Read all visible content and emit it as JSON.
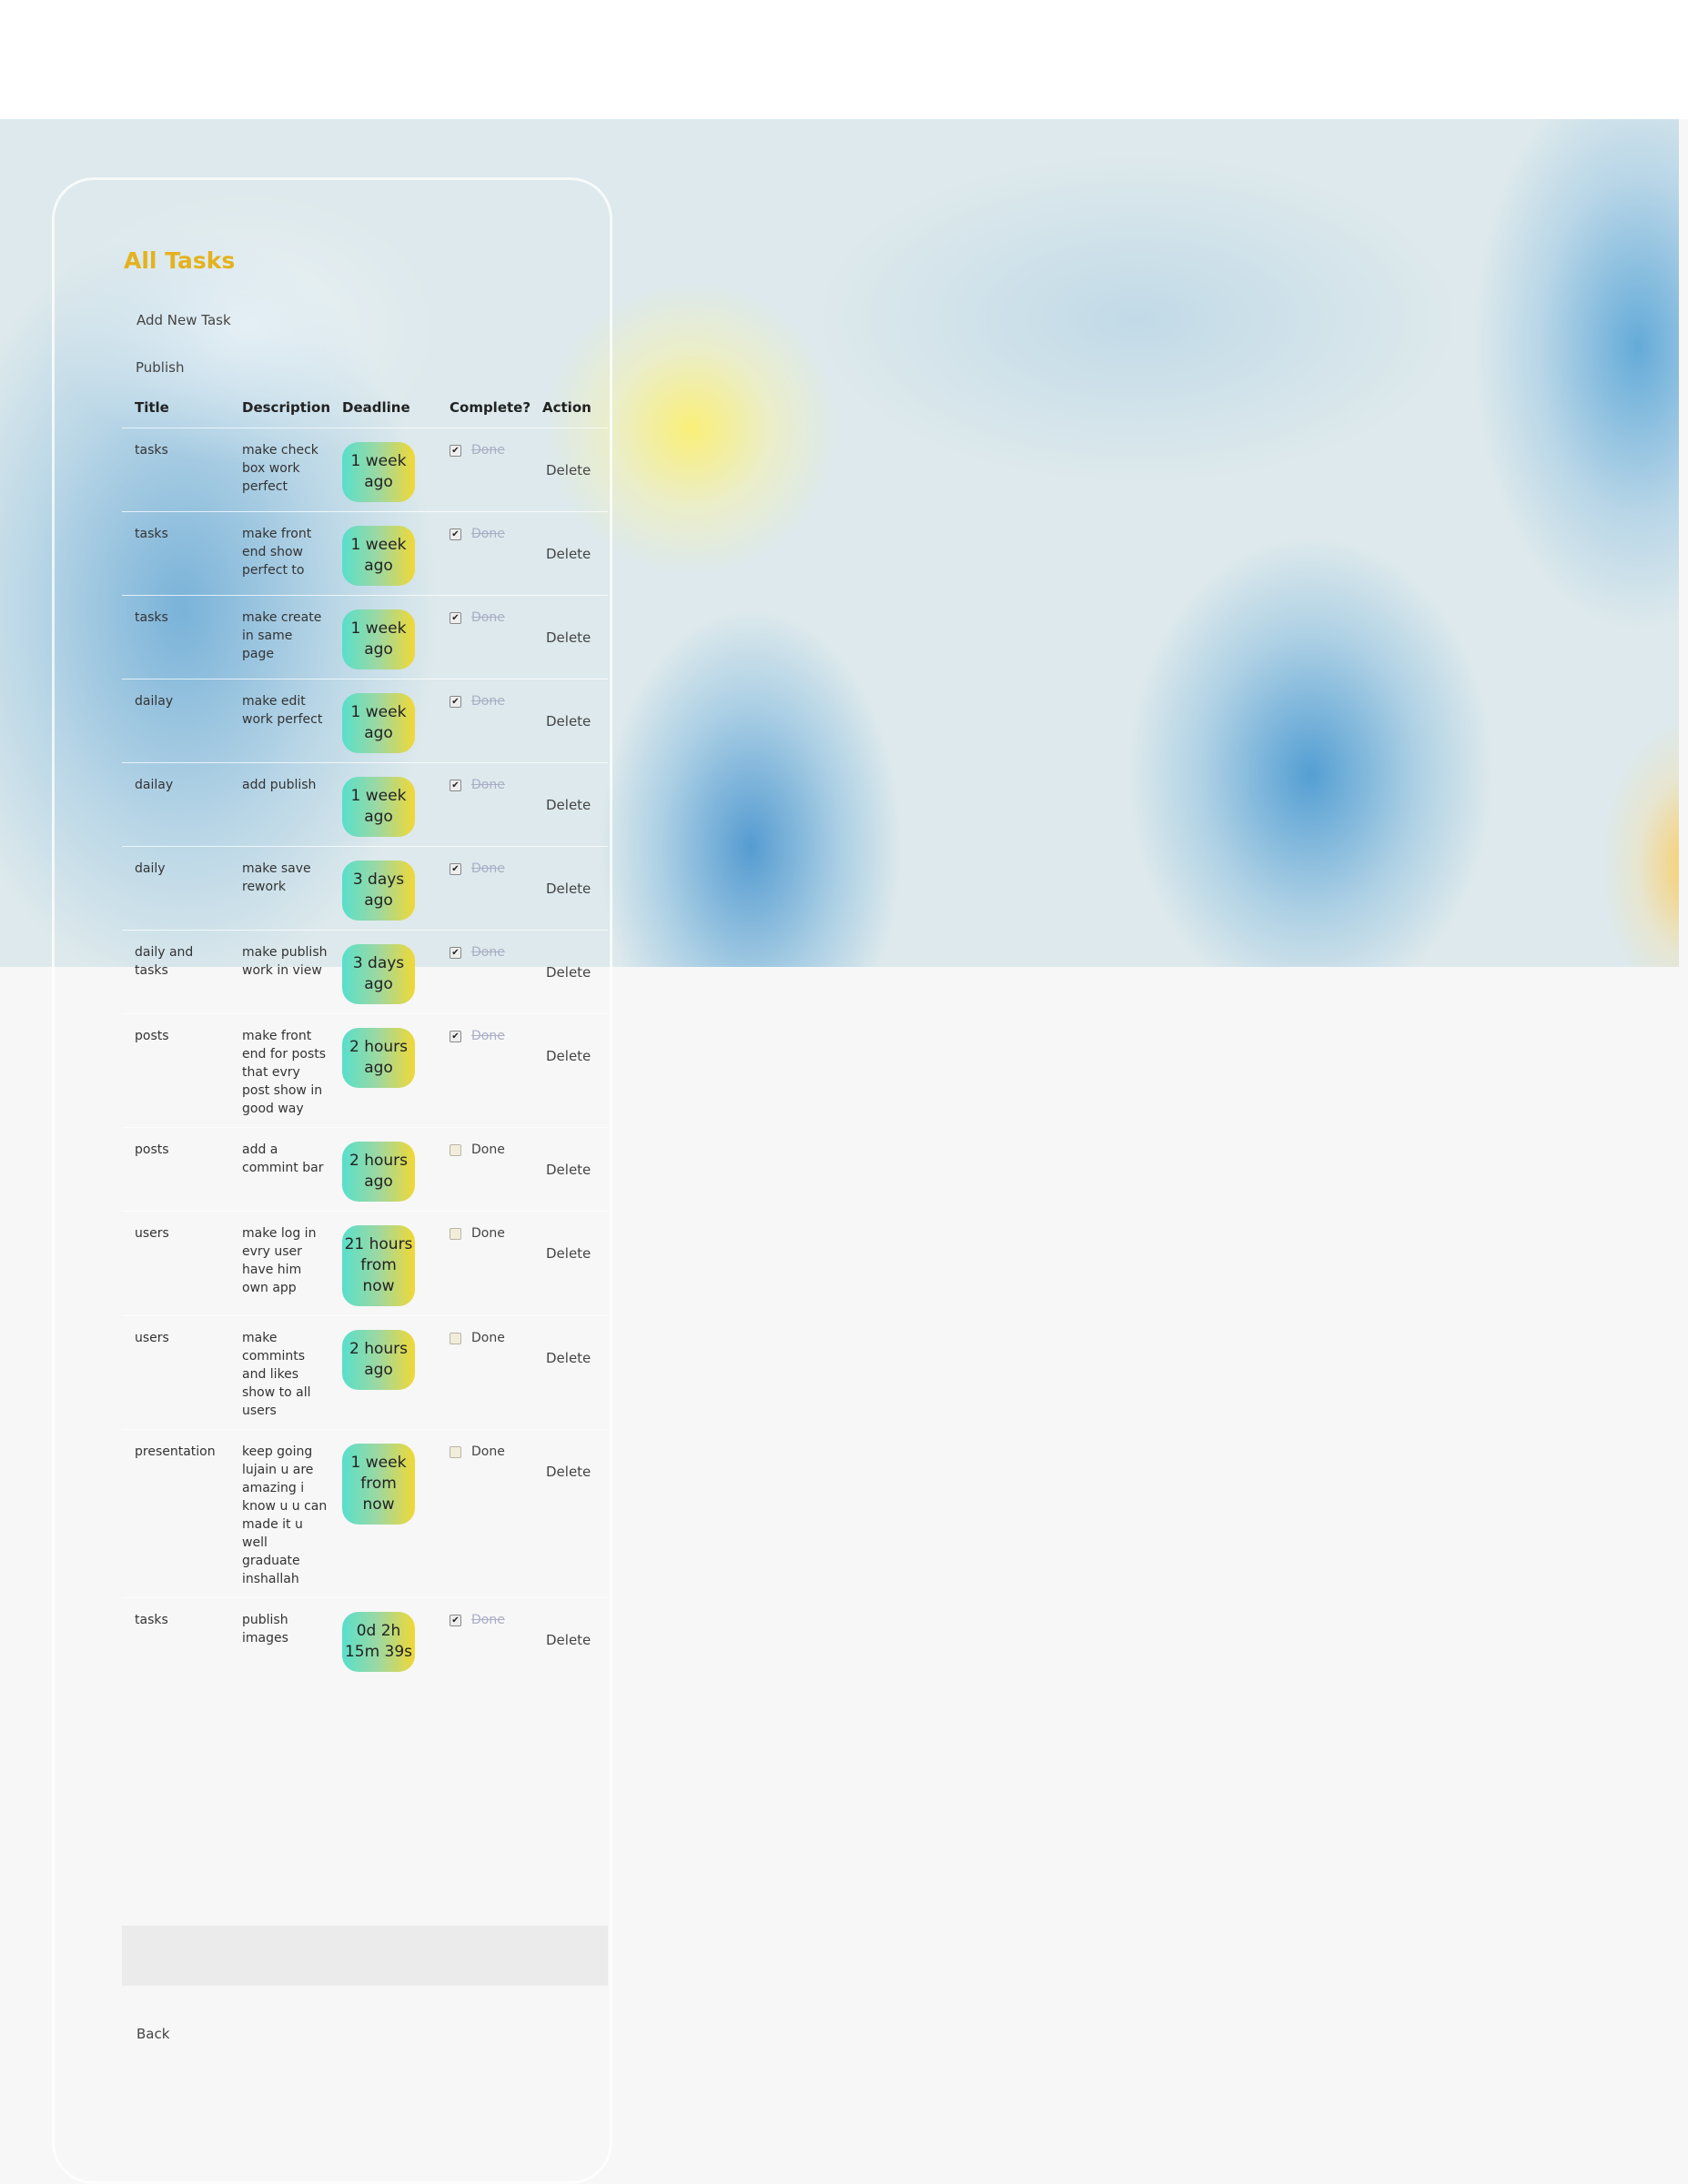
{
  "page": {
    "title": "All Tasks",
    "add_link": "Add New Task",
    "publish_link": "Publish",
    "back_link": "Back",
    "accent_color": "#e3b21e",
    "badge_gradient": [
      "#58dfcb",
      "#f1d835"
    ]
  },
  "table": {
    "headers": [
      "Title",
      "Description",
      "Deadline",
      "Complete?",
      "Action"
    ],
    "rows": [
      {
        "title": "tasks",
        "description": "make check box work perfect",
        "deadline": "1 week ago",
        "complete": true,
        "done_label": "Done",
        "action": "Delete"
      },
      {
        "title": "tasks",
        "description": "make front end show perfect to",
        "deadline": "1 week ago",
        "complete": true,
        "done_label": "Done",
        "action": "Delete"
      },
      {
        "title": "tasks",
        "description": "make create in same page",
        "deadline": "1 week ago",
        "complete": true,
        "done_label": "Done",
        "action": "Delete"
      },
      {
        "title": "dailay",
        "description": "make edit work perfect",
        "deadline": "1 week ago",
        "complete": true,
        "done_label": "Done",
        "action": "Delete"
      },
      {
        "title": "dailay",
        "description": "add publish",
        "deadline": "1 week ago",
        "complete": true,
        "done_label": "Done",
        "action": "Delete"
      },
      {
        "title": "daily",
        "description": "make save rework",
        "deadline": "3 days ago",
        "complete": true,
        "done_label": "Done",
        "action": "Delete"
      },
      {
        "title": "daily and tasks",
        "description": "make publish work in view",
        "deadline": "3 days ago",
        "complete": true,
        "done_label": "Done",
        "action": "Delete"
      },
      {
        "title": "posts",
        "description": "make front end for posts that evry post show in good way",
        "deadline": "2 hours ago",
        "complete": true,
        "done_label": "Done",
        "action": "Delete"
      },
      {
        "title": "posts",
        "description": "add a commint bar",
        "deadline": "2 hours ago",
        "complete": false,
        "done_label": "Done",
        "action": "Delete"
      },
      {
        "title": "users",
        "description": "make log in evry user have him own app",
        "deadline": "21 hours from now",
        "complete": false,
        "done_label": "Done",
        "action": "Delete"
      },
      {
        "title": "users",
        "description": "make commints and likes show to all users",
        "deadline": "2 hours ago",
        "complete": false,
        "done_label": "Done",
        "action": "Delete"
      },
      {
        "title": "presentation",
        "description": "keep going lujain u are amazing i know u u can made it u well graduate inshallah",
        "deadline": "1 week from now",
        "complete": false,
        "done_label": "Done",
        "action": "Delete"
      },
      {
        "title": "tasks",
        "description": "publish images",
        "deadline": "0d 2h 15m 39s",
        "complete": true,
        "done_label": "Done",
        "action": "Delete"
      }
    ]
  }
}
